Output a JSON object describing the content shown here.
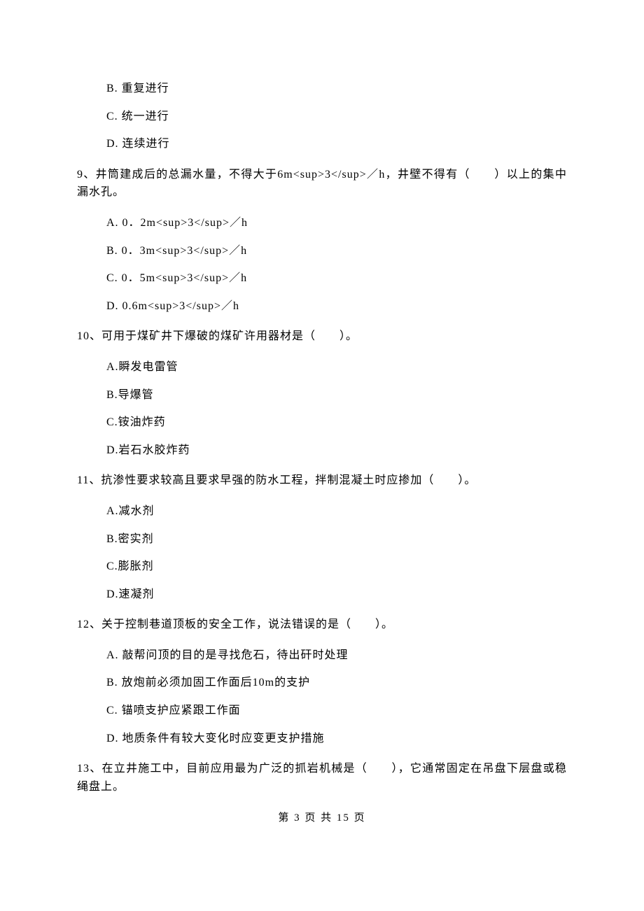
{
  "q8_options": {
    "b": "B. 重复进行",
    "c": "C. 统一进行",
    "d": "D. 连续进行"
  },
  "q9": {
    "text": "9、井筒建成后的总漏水量，不得大于6m<sup>3</sup>／h，井壁不得有（　　）以上的集中漏水孔。",
    "a": "A. 0．2m<sup>3</sup>／h",
    "b": "B. 0．3m<sup>3</sup>／h",
    "c": "C. 0．5m<sup>3</sup>／h",
    "d": "D. 0.6m<sup>3</sup>／h"
  },
  "q10": {
    "text": "10、可用于煤矿井下爆破的煤矿许用器材是（　　）。",
    "a": "A.瞬发电雷管",
    "b": "B.导爆管",
    "c": "C.铵油炸药",
    "d": "D.岩石水胶炸药"
  },
  "q11": {
    "text": "11、抗渗性要求较高且要求早强的防水工程，拌制混凝土时应掺加（　　）。",
    "a": "A.减水剂",
    "b": "B.密实剂",
    "c": "C.膨胀剂",
    "d": "D.速凝剂"
  },
  "q12": {
    "text": "12、关于控制巷道顶板的安全工作，说法错误的是（　　）。",
    "a": "A. 敲帮问顶的目的是寻找危石，待出矸时处理",
    "b": "B. 放炮前必须加固工作面后10m的支护",
    "c": "C. 锚喷支护应紧跟工作面",
    "d": "D. 地质条件有较大变化时应变更支护措施"
  },
  "q13": {
    "text": "13、在立井施工中，目前应用最为广泛的抓岩机械是（　　），它通常固定在吊盘下层盘或稳绳盘上。"
  },
  "footer": "第 3 页 共 15 页"
}
